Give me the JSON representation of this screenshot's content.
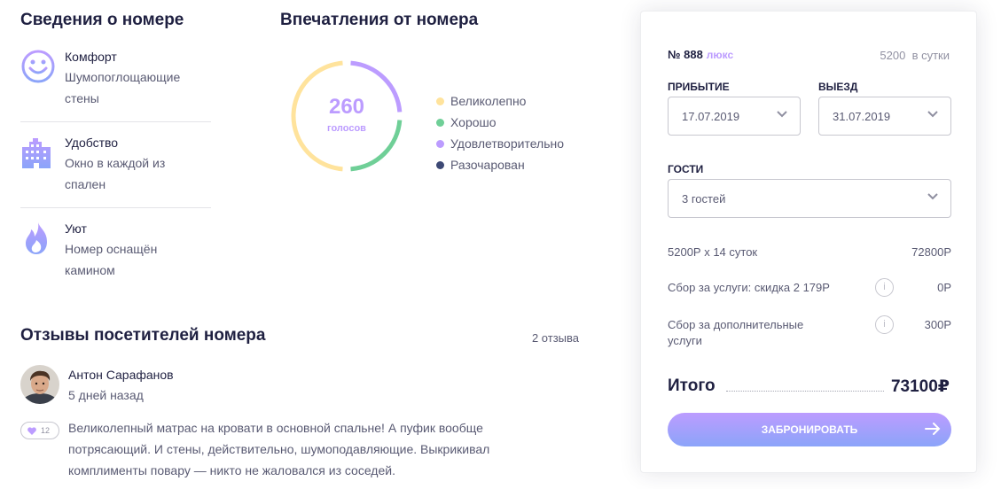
{
  "details": {
    "title": "Сведения о номере",
    "features": [
      {
        "icon": "smiley-icon",
        "title": "Комфорт",
        "desc1": "Шумопоглощающие",
        "desc2": "стены"
      },
      {
        "icon": "building-icon",
        "title": "Удобство",
        "desc1": "Окно в каждой из",
        "desc2": "спален"
      },
      {
        "icon": "fire-icon",
        "title": "Уют",
        "desc1": "Номер оснащён",
        "desc2": "камином"
      }
    ]
  },
  "impressions": {
    "title": "Впечатления от номера",
    "votes": "260",
    "votes_caption": "голосов",
    "legend": [
      {
        "label": "Великолепно",
        "color": "#ffe39c"
      },
      {
        "label": "Хорошо",
        "color": "#6fcf97"
      },
      {
        "label": "Удовлетворительно",
        "color": "#bc9cff"
      },
      {
        "label": "Разочарован",
        "color": "#3d4975"
      }
    ],
    "segments_fraction": {
      "Удовлетворительно": 0.25,
      "Хорошо": 0.25,
      "Великолепно": 0.5,
      "Разочарован": 0
    }
  },
  "reviews": {
    "title": "Отзывы посетителей номера",
    "count": "2 отзыва",
    "items": [
      {
        "name": "Антон Сарафанов",
        "date": "5 дней назад",
        "likes": "12",
        "text": "Великолепный матрас на кровати в основной спальне! А пуфик вообще потрясающий. И стены, действительно, шумоподавляющие. Выкрикивал комплименты повару — никто не жаловался из соседей."
      }
    ]
  },
  "booking": {
    "room_number": "№ 888",
    "room_type": "люкс",
    "price": "5200",
    "price_unit": "в сутки",
    "arrival_label": "прибытие",
    "arrival_value": "17.07.2019",
    "departure_label": "выезд",
    "departure_value": "31.07.2019",
    "guests_label": "гости",
    "guests_value": "3 гостей",
    "line1_label": "5200Р х 14 суток",
    "line1_value": "72800Р",
    "line2_label": "Сбор за услуги: скидка 2 179Р",
    "line2_value": "0Р",
    "line3_label1": "Сбор за дополнительные",
    "line3_label2": "услуги",
    "line3_value": "300Р",
    "info_glyph": "i",
    "total_label": "Итого",
    "total_value": "73100₽",
    "book_label": "забронировать",
    "accent": "#bc9cff",
    "accent2": "#8ba4f9"
  }
}
